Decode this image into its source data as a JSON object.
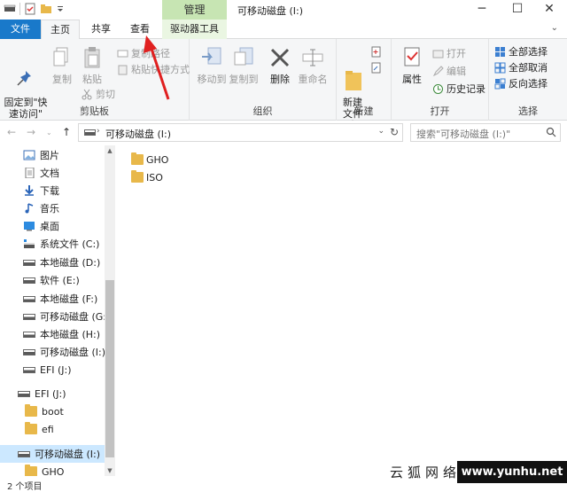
{
  "window": {
    "title": "可移动磁盘 (I:)",
    "manage_label": "管理",
    "minimize": "─",
    "maximize": "☐",
    "close": "✕"
  },
  "tabs": {
    "file": "文件",
    "home": "主页",
    "share": "共享",
    "view": "查看",
    "drive_tools": "驱动器工具",
    "expand": "⌄"
  },
  "ribbon": {
    "clipboard": {
      "label": "剪贴板",
      "pin": "固定到\"快\n速访问\"",
      "copy": "复制",
      "paste": "粘贴",
      "copy_path": "复制路径",
      "paste_shortcut": "粘贴快捷方式",
      "cut": "剪切"
    },
    "organize": {
      "label": "组织",
      "move_to": "移动到",
      "copy_to": "复制到",
      "delete": "删除",
      "rename": "重命名"
    },
    "new": {
      "label": "新建",
      "new_folder": "新建\n文件夹"
    },
    "open": {
      "label": "打开",
      "properties": "属性",
      "open": "打开",
      "edit": "编辑",
      "history": "历史记录"
    },
    "select": {
      "label": "选择",
      "select_all": "全部选择",
      "select_none": "全部取消",
      "invert": "反向选择"
    }
  },
  "address": {
    "path": "可移动磁盘 (I:)",
    "search_placeholder": "搜索\"可移动磁盘 (I:)\""
  },
  "nav": {
    "items": [
      {
        "label": "图片",
        "icon": "pictures-icon"
      },
      {
        "label": "文档",
        "icon": "documents-icon"
      },
      {
        "label": "下载",
        "icon": "download-icon"
      },
      {
        "label": "音乐",
        "icon": "music-icon"
      },
      {
        "label": "桌面",
        "icon": "desktop-icon"
      },
      {
        "label": "系统文件 (C:)",
        "icon": "system-drive-icon"
      },
      {
        "label": "本地磁盘 (D:)",
        "icon": "drive-icon"
      },
      {
        "label": "软件 (E:)",
        "icon": "drive-icon"
      },
      {
        "label": "本地磁盘 (F:)",
        "icon": "drive-icon"
      },
      {
        "label": "可移动磁盘 (G:)",
        "icon": "drive-icon"
      },
      {
        "label": "本地磁盘 (H:)",
        "icon": "drive-icon"
      },
      {
        "label": "可移动磁盘 (I:)",
        "icon": "drive-icon"
      },
      {
        "label": "EFI (J:)",
        "icon": "drive-icon"
      },
      {
        "label": "EFI (J:)",
        "icon": "drive-icon"
      },
      {
        "label": "boot",
        "icon": "folder-icon"
      },
      {
        "label": "efi",
        "icon": "folder-icon"
      },
      {
        "label": "可移动磁盘 (I:)",
        "icon": "drive-icon"
      },
      {
        "label": "GHO",
        "icon": "folder-icon"
      }
    ]
  },
  "files": [
    {
      "name": "GHO"
    },
    {
      "name": "ISO"
    }
  ],
  "status": {
    "count": "2 个项目"
  },
  "watermark": {
    "cn": "云狐网络",
    "url": "www.yunhu.net"
  },
  "colors": {
    "file_tab": "#1979ca",
    "manage_tab": "#c7e5b3",
    "selection": "#cce8ff",
    "annotation_arrow": "#e02020"
  }
}
